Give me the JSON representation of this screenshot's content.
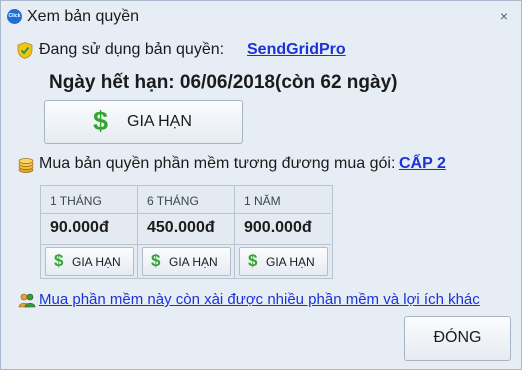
{
  "window": {
    "title": "Xem bản quyền",
    "app_icon_text": "Click",
    "close_glyph": "×"
  },
  "license": {
    "label": "Đang sử dụng bản quyền:",
    "name": "SendGridPro",
    "expiry": "Ngày hết hạn: 06/06/2018(còn 62 ngày)",
    "renew_label": "GIA HẠN",
    "renew_icon": "$"
  },
  "purchase": {
    "label": "Mua bản quyền phần mềm tương đương mua gói:",
    "package_link": "CẤP 2",
    "plans": [
      {
        "duration": "1 THÁNG",
        "price": "90.000đ",
        "button": "GIA HẠN",
        "icon": "$"
      },
      {
        "duration": "6 THÁNG",
        "price": "450.000đ",
        "button": "GIA HẠN",
        "icon": "$"
      },
      {
        "duration": "1 NĂM",
        "price": "900.000đ",
        "button": "GIA HẠN",
        "icon": "$"
      }
    ]
  },
  "more": {
    "link": "Mua phần mềm này còn xài được nhiều phần mềm và lợi ích khác"
  },
  "footer": {
    "close_label": "ĐÓNG"
  },
  "colors": {
    "link": "#1a33d6",
    "dollar": "#34a534",
    "background": "#e7edf5"
  }
}
